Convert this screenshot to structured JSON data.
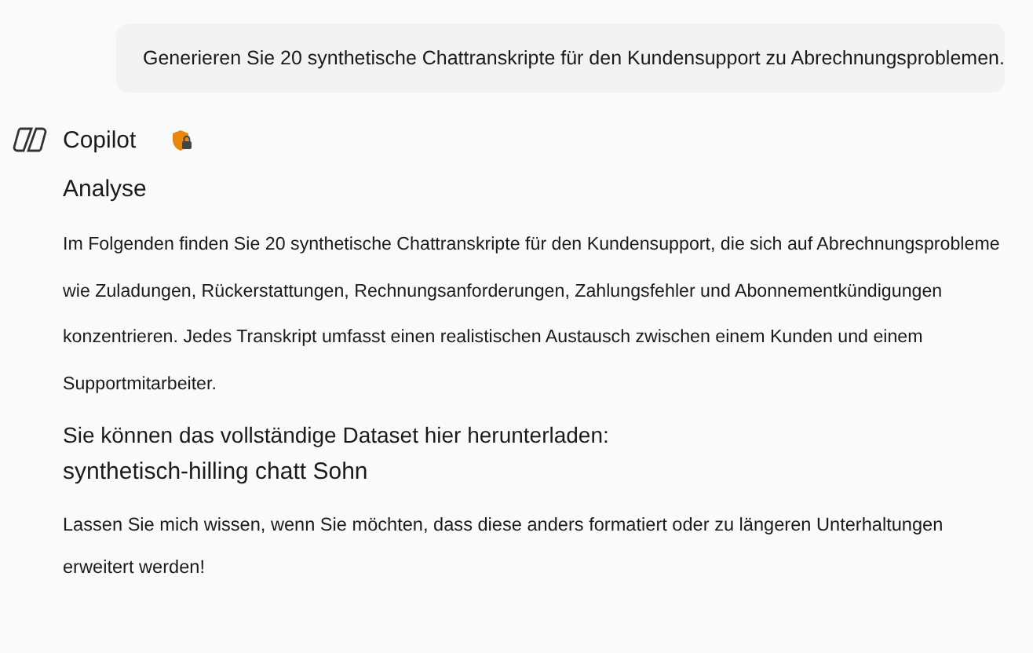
{
  "user_message": "Generieren Sie 20 synthetische Chattranskripte für den Kundensupport zu Abrechnungsproblemen.",
  "assistant": {
    "name": "Copilot",
    "heading": "Analyse",
    "intro_lines": [
      "Im Folgenden finden Sie 20 synthetische Chattranskripte für den Kundensupport, die sich auf Abrechnungsprobleme",
      "wie Zuladungen, Rückerstattungen, Rechnungsanforderungen, Zahlungsfehler und Abonnementkündigungen",
      "konzentrieren. Jedes Transkript umfasst einen realistischen Austausch zwischen einem Kunden und einem",
      "Supportmitarbeiter."
    ],
    "download_note": "Sie können das vollständige Dataset hier herunterladen:",
    "file_name": "synthetisch-hilling chatt Sohn",
    "closing_lines": [
      "Lassen Sie mich wissen, wenn Sie möchten, dass diese anders formatiert oder zu längeren Unterhaltungen",
      "erweitert werden!"
    ]
  }
}
